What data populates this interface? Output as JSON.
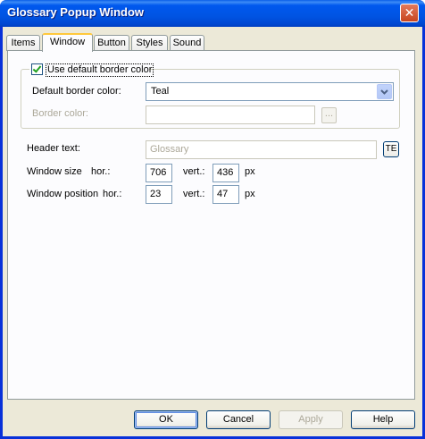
{
  "window": {
    "title": "Glossary Popup Window",
    "close_glyph": "✕"
  },
  "tabs": [
    {
      "label": "Items",
      "active": false
    },
    {
      "label": "Window",
      "active": true
    },
    {
      "label": "Button",
      "active": false
    },
    {
      "label": "Styles",
      "active": false
    },
    {
      "label": "Sound",
      "active": false
    }
  ],
  "border": {
    "use_default_label": "Use default border color",
    "use_default_checked": true,
    "default_color_label": "Default border color:",
    "default_color_value": "Teal",
    "border_color_label": "Border color:",
    "border_color_value": "",
    "browse_label": "..."
  },
  "header": {
    "label": "Header text:",
    "value": "Glossary",
    "te_label": "TE"
  },
  "size": {
    "label": "Window size",
    "hor_label": "hor.:",
    "hor_value": "706",
    "vert_label": "vert.:",
    "vert_value": "436",
    "unit": "px"
  },
  "position": {
    "label": "Window position",
    "hor_label": "hor.:",
    "hor_value": "23",
    "vert_label": "vert.:",
    "vert_value": "47",
    "unit": "px"
  },
  "buttons": {
    "ok": "OK",
    "cancel": "Cancel",
    "apply": "Apply",
    "help": "Help"
  },
  "colors": {
    "titlebar": "#0054e3",
    "dialog_bg": "#ece9d8",
    "active_tab_accent": "#ffc83c"
  }
}
